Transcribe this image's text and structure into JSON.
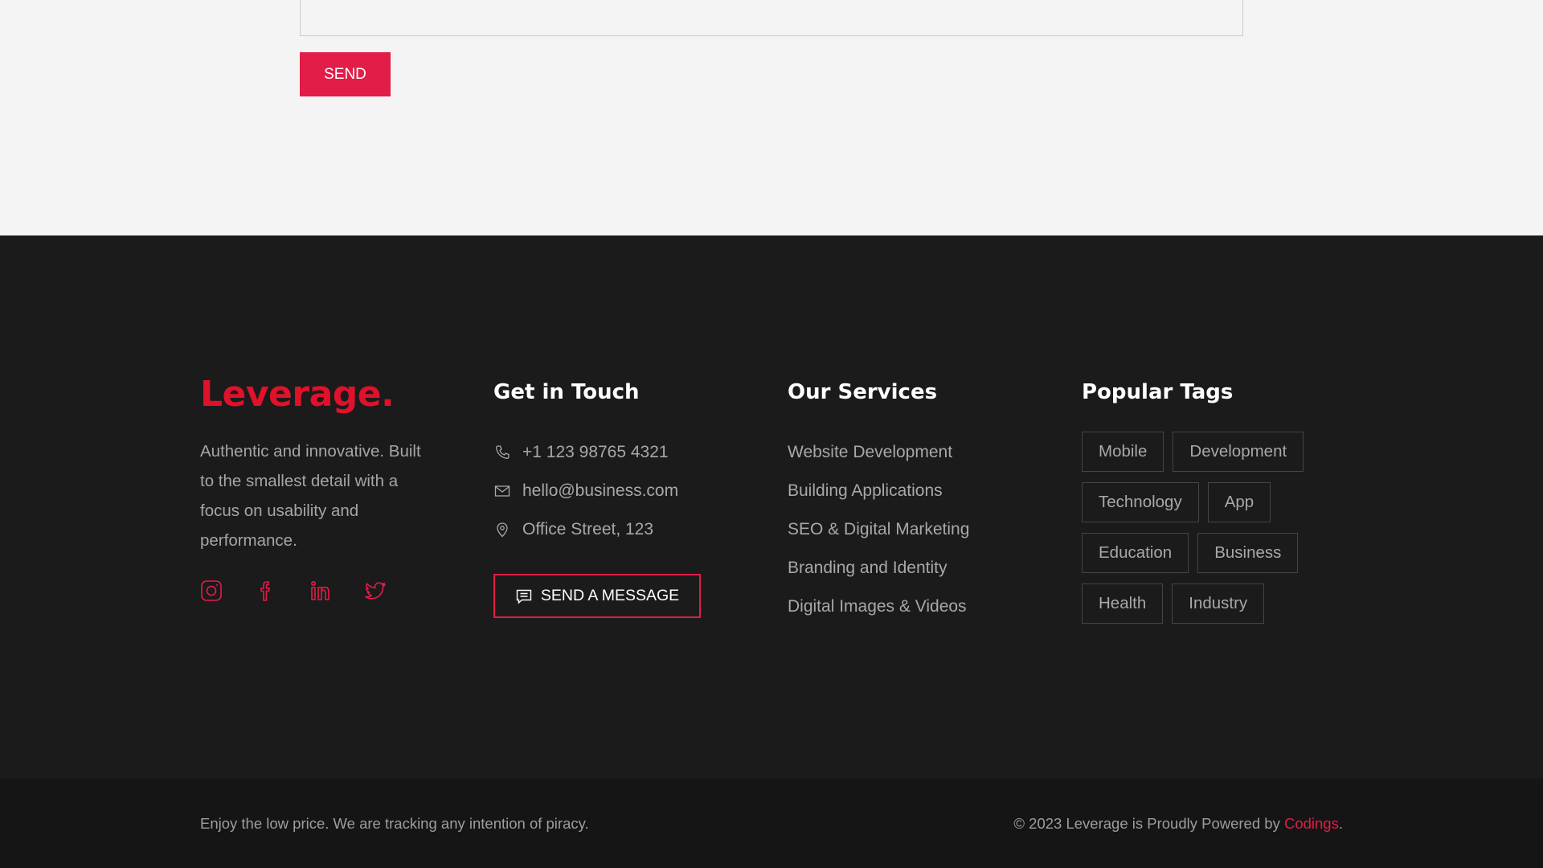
{
  "form": {
    "send_label": "SEND"
  },
  "brand": {
    "logo_text": "Leverage.",
    "description": "Authentic and innovative. Built to the smallest detail with a focus on usability and performance.",
    "socials": [
      {
        "name": "instagram-icon"
      },
      {
        "name": "facebook-icon"
      },
      {
        "name": "linkedin-icon"
      },
      {
        "name": "twitter-icon"
      }
    ]
  },
  "contact": {
    "heading": "Get in Touch",
    "phone": "+1 123 98765 4321",
    "email": "hello@business.com",
    "address": "Office Street, 123",
    "message_button": "SEND A MESSAGE"
  },
  "services": {
    "heading": "Our Services",
    "items": [
      "Website Development",
      "Building Applications",
      "SEO & Digital Marketing",
      "Branding and Identity",
      "Digital Images & Videos"
    ]
  },
  "tags": {
    "heading": "Popular Tags",
    "items": [
      "Mobile",
      "Development",
      "Technology",
      "App",
      "Education",
      "Business",
      "Health",
      "Industry"
    ]
  },
  "bottom": {
    "notice": "Enjoy the low price. We are tracking any intention of piracy.",
    "copyright_prefix": "© 2023 Leverage is Proudly Powered by ",
    "powered_by": "Codings",
    "copyright_suffix": "."
  },
  "colors": {
    "accent": "#e11d48",
    "logo": "#e0112b",
    "footer_bg": "#1b1b1b",
    "bottom_bg": "#151515",
    "page_bg": "#f4f4f4"
  }
}
